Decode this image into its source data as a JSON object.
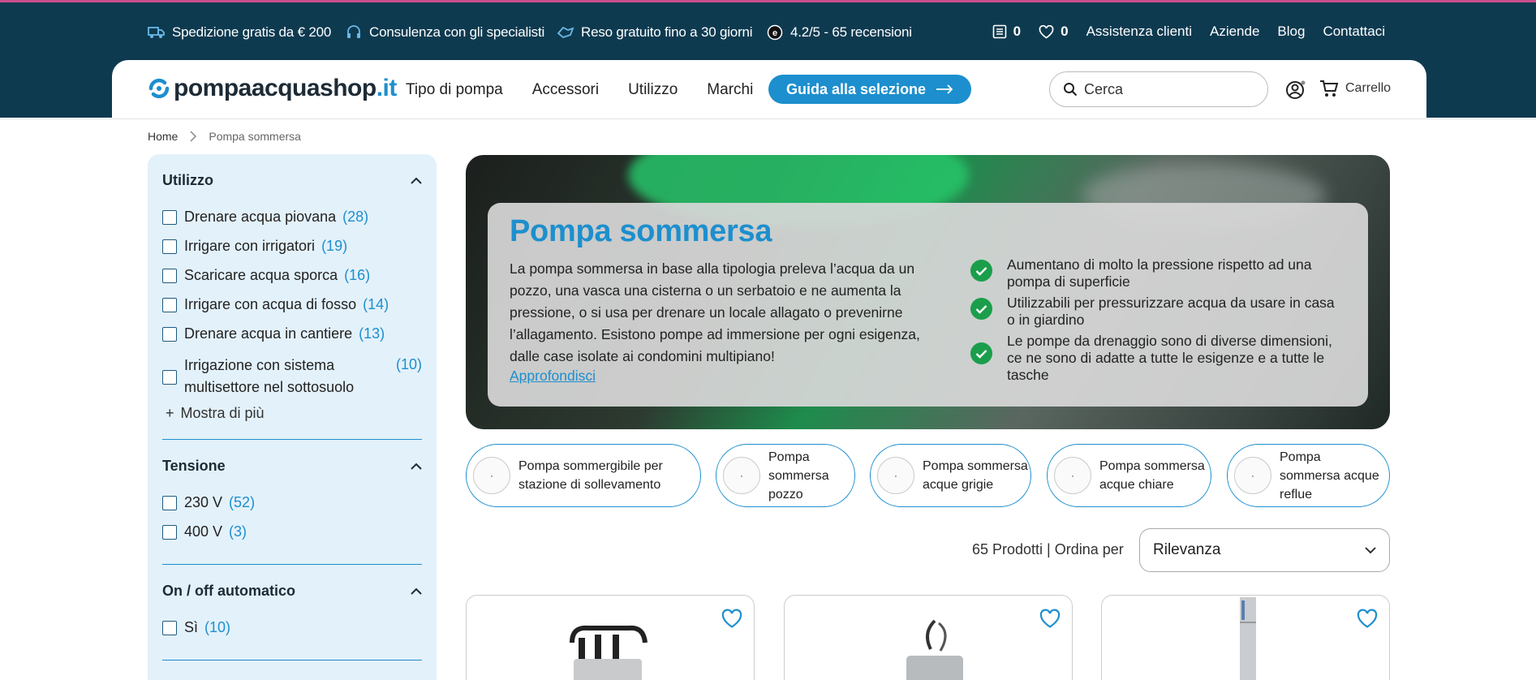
{
  "topbar": {
    "usps": [
      {
        "icon": "truck-icon",
        "label": "Spedizione gratis da € 200"
      },
      {
        "icon": "headset-icon",
        "label": "Consulenza con gli specialisti"
      },
      {
        "icon": "return-icon",
        "label": "Reso gratuito fino a 30 giorni"
      },
      {
        "icon": "rating-icon",
        "label": "4.2/5 - 65 recensioni"
      }
    ],
    "compare_count": "0",
    "wishlist_count": "0",
    "links": [
      "Assistenza clienti",
      "Aziende",
      "Blog",
      "Contattaci"
    ]
  },
  "header": {
    "logo_main": "pompaacquashop",
    "logo_tld": ".it",
    "nav": [
      "Tipo di pompa",
      "Accessori",
      "Utilizzo",
      "Marchi"
    ],
    "guide_button": "Guida alla selezione",
    "search_placeholder": "Cerca",
    "cart_label": "Carrello"
  },
  "breadcrumb": {
    "home": "Home",
    "current": "Pompa sommersa"
  },
  "filters": {
    "utilizzo": {
      "title": "Utilizzo",
      "options": [
        {
          "label": "Drenare acqua piovana",
          "count": "(28)"
        },
        {
          "label": "Irrigare con irrigatori",
          "count": "(19)"
        },
        {
          "label": "Scaricare acqua sporca",
          "count": "(16)"
        },
        {
          "label": "Irrigare con acqua di fosso",
          "count": "(14)"
        },
        {
          "label": "Drenare acqua in cantiere",
          "count": "(13)"
        },
        {
          "label": "Irrigazione con sistema multisettore nel sottosuolo",
          "count": "(10)"
        }
      ],
      "more": "Mostra di più"
    },
    "tensione": {
      "title": "Tensione",
      "options": [
        {
          "label": "230 V",
          "count": "(52)"
        },
        {
          "label": "400 V",
          "count": "(3)"
        }
      ]
    },
    "onoff": {
      "title": "On / off automatico",
      "options": [
        {
          "label": "Sì",
          "count": "(10)"
        }
      ]
    }
  },
  "hero": {
    "title": "Pompa sommersa",
    "description": "La pompa sommersa in base alla tipologia preleva l’acqua da un pozzo, una vasca una cisterna o un serbatoio e ne aumenta la pressione, o si usa per drenare un locale allagato o prevenirne l’allagamento. Esistono pompe ad immersione per ogni esigenza, dalle case isolate ai condomini multipiano!",
    "link": "Approfondisci",
    "bullets": [
      "Aumentano di molto la pressione rispetto ad una pompa di superficie",
      "Utilizzabili per pressurizzare acqua da usare in casa o in giardino",
      "Le pompe da drenaggio sono di diverse dimensioni, ce ne sono di adatte a tutte le esigenze e a tutte le tasche"
    ]
  },
  "categories": [
    "Pompa sommergibile per stazione di sollevamento",
    "Pompa sommersa pozzo",
    "Pompa sommersa acque grigie",
    "Pompa sommersa acque chiare",
    "Pompa sommersa acque reflue"
  ],
  "listing": {
    "count_label": "65 Prodotti | Ordina per",
    "sort_value": "Rilevanza"
  },
  "colors": {
    "topbar": "#0e3a50",
    "accent": "#1d8fce",
    "sidebar_bg": "#e3f1fa",
    "check_green": "#1b9e4b"
  }
}
